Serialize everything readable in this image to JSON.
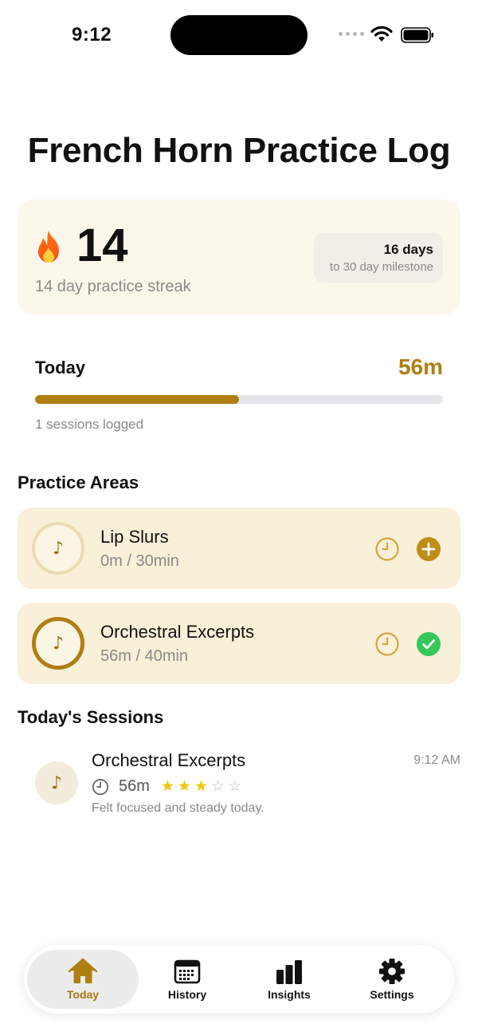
{
  "status_bar": {
    "time": "9:12"
  },
  "page": {
    "title": "French Horn Practice Log"
  },
  "streak": {
    "count": "14",
    "caption": "14 day practice streak",
    "milestone_days": "16 days",
    "milestone_label": "to 30 day milestone"
  },
  "today": {
    "label": "Today",
    "minutes": "56m",
    "progress_fraction": 0.5,
    "sessions_logged": "1 sessions logged"
  },
  "practice_areas": {
    "heading": "Practice Areas",
    "items": [
      {
        "name": "Lip Slurs",
        "progress": "0m / 30min",
        "completed": false
      },
      {
        "name": "Orchestral Excerpts",
        "progress": "56m / 40min",
        "completed": true
      }
    ]
  },
  "sessions": {
    "heading": "Today's Sessions",
    "items": [
      {
        "title": "Orchestral Excerpts",
        "time": "9:12 AM",
        "duration": "56m",
        "rating": 3,
        "rating_max": 5,
        "note": "Felt focused and steady today."
      }
    ]
  },
  "tabs": [
    {
      "label": "Today",
      "icon": "house-icon",
      "active": true
    },
    {
      "label": "History",
      "icon": "calendar-icon",
      "active": false
    },
    {
      "label": "Insights",
      "icon": "bar-chart-icon",
      "active": false
    },
    {
      "label": "Settings",
      "icon": "gear-icon",
      "active": false
    }
  ],
  "colors": {
    "accent": "#b07f12",
    "card_background": "#f8f0d9",
    "streak_card_background": "#fbf7ea",
    "complete_green": "#34c759"
  }
}
